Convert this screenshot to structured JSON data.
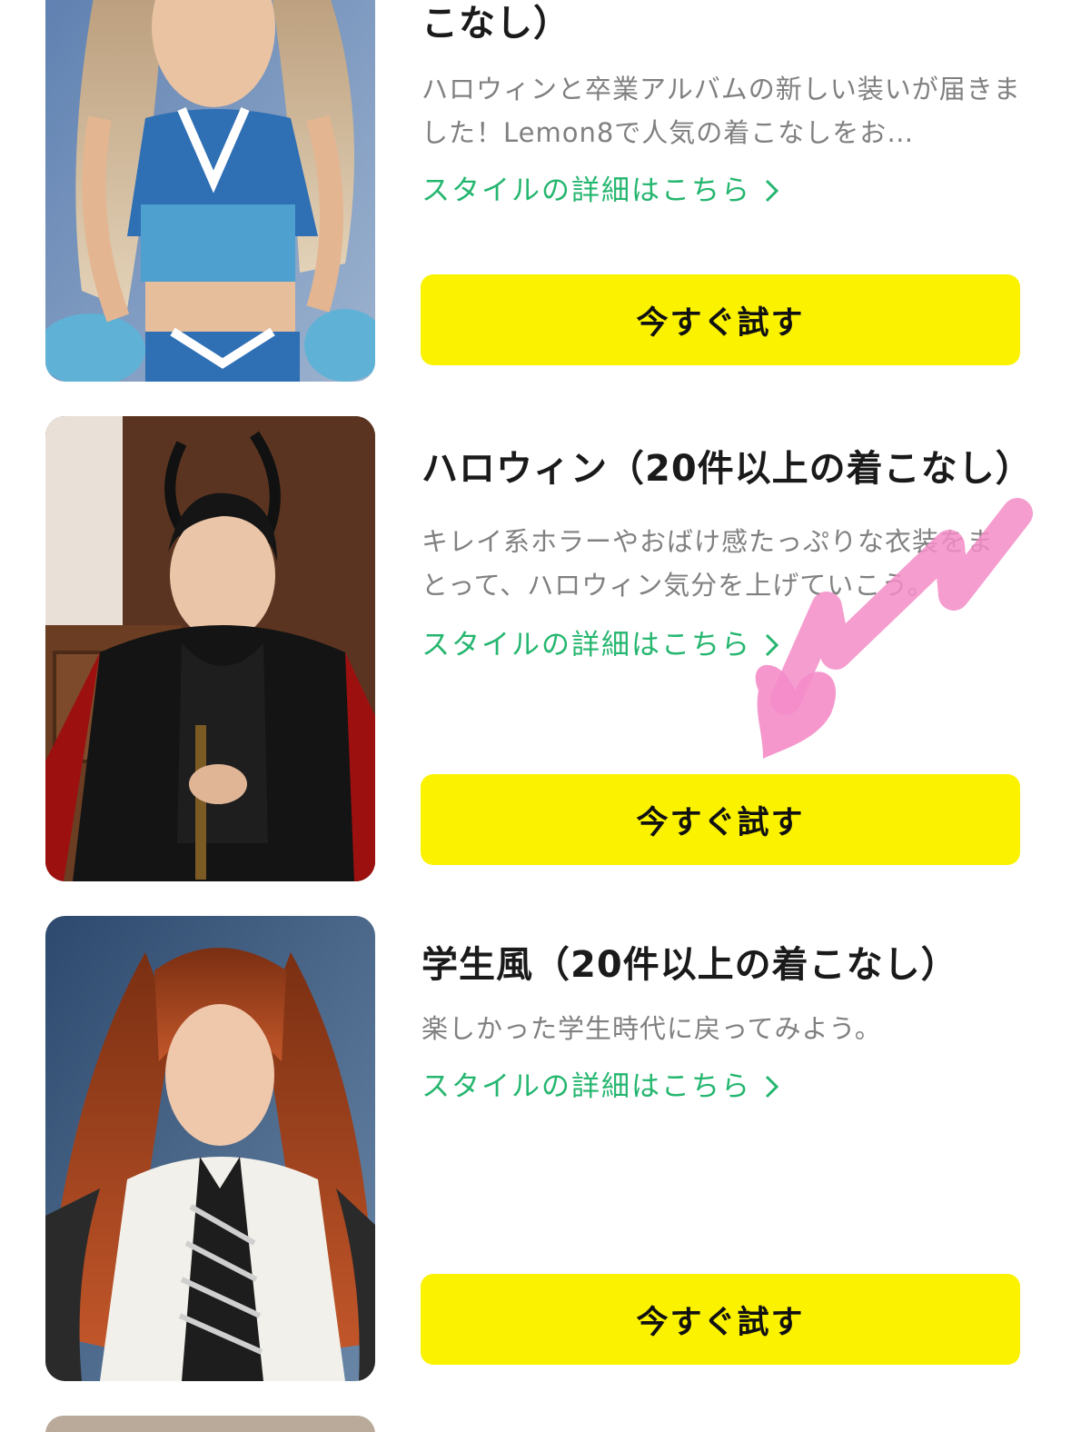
{
  "cards": [
    {
      "title": "こなし）",
      "description": "ハロウィンと卒業アルバムの新しい装いが届きました！Lemon8で人気の着こなしをお…",
      "link": "スタイルの詳細はこちら",
      "button": "今すぐ試す",
      "image": "cheerleader-photo"
    },
    {
      "title": "ハロウィン（20件以上の着こなし）",
      "description": "キレイ系ホラーやおばけ感たっぷりな衣装をまとって、ハロウィン気分を上げていこう。",
      "link": "スタイルの詳細はこちら",
      "button": "今すぐ試す",
      "image": "halloween-demon-photo"
    },
    {
      "title": "学生風（20件以上の着こなし）",
      "description": "楽しかった学生時代に戻ってみよう。",
      "link": "スタイルの詳細はこちら",
      "button": "今すぐ試す",
      "image": "student-uniform-photo"
    }
  ],
  "colors": {
    "button_bg": "#fbf200",
    "link": "#25b66f",
    "title": "#1a1a1a",
    "description": "#808080",
    "annotation_arrow": "#f48cc8"
  },
  "icons": [
    "chevron-right-icon",
    "pink-heart-arrow-annotation"
  ]
}
